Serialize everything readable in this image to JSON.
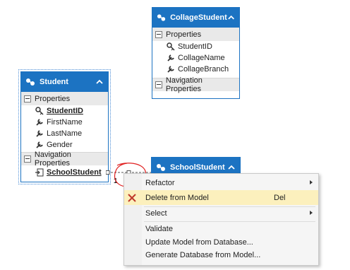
{
  "entities": {
    "collage_student": {
      "title": "CollageStudent",
      "properties_label": "Properties",
      "properties": [
        "StudentID",
        "CollageName",
        "CollageBranch"
      ],
      "nav_label": "Navigation Properties"
    },
    "student": {
      "title": "Student",
      "properties_label": "Properties",
      "properties": [
        "StudentID",
        "FirstName",
        "LastName",
        "Gender"
      ],
      "nav_label": "Navigation Properties",
      "nav_properties": [
        "SchoolStudent"
      ]
    },
    "school_student": {
      "title": "SchoolStudent"
    }
  },
  "association": {
    "multiplicity": "1"
  },
  "context_menu": {
    "items": [
      {
        "label": "Refactor",
        "submenu": true
      },
      {
        "label": "Delete from Model",
        "shortcut": "Del",
        "icon": "delete-x-icon",
        "highlighted": true
      },
      {
        "label": "Select",
        "submenu": true
      },
      {
        "label": "Validate"
      },
      {
        "label": "Update Model from Database..."
      },
      {
        "label": "Generate Database from Model..."
      }
    ]
  },
  "colors": {
    "entity_header": "#1c73c2",
    "section_bg": "#e9e9e9",
    "menu_highlight": "#fcf0bd",
    "delete_icon": "#c0392b",
    "annotation_circle": "#e02020"
  }
}
